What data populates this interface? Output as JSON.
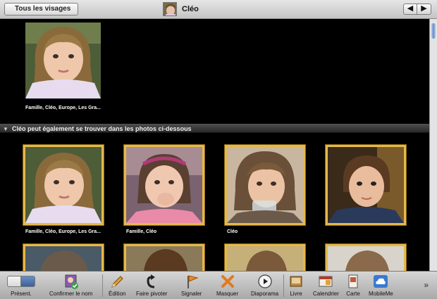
{
  "header": {
    "back_label": "Tous les visages",
    "title": "Cléo",
    "prev_label": "◀",
    "next_label": "▶"
  },
  "main_face": {
    "caption": "Famille, Cléo, Europe, Les Gra..."
  },
  "section": {
    "label": "Cléo peut également se trouver dans les photos ci-dessous"
  },
  "photos": [
    {
      "caption": "Famille, Cléo, Europe, Les Gra..."
    },
    {
      "caption": "Famille, Cléo"
    },
    {
      "caption": "Cléo"
    },
    {
      "caption": ""
    }
  ],
  "toolbar": {
    "present_label": "Présent.",
    "confirm_label": "Confirmer le nom",
    "edit_label": "Édition",
    "rotate_label": "Faire pivoter",
    "flag_label": "Signaler",
    "hide_label": "Masquer",
    "slideshow_label": "Diaporama",
    "book_label": "Livre",
    "calendar_label": "Calendrier",
    "card_label": "Carte",
    "mobileme_label": "MobileMe",
    "more_label": "»"
  },
  "colors": {
    "selection_border": "#e6b84a",
    "background": "#000000",
    "toolbar": "#c0c0c0"
  }
}
